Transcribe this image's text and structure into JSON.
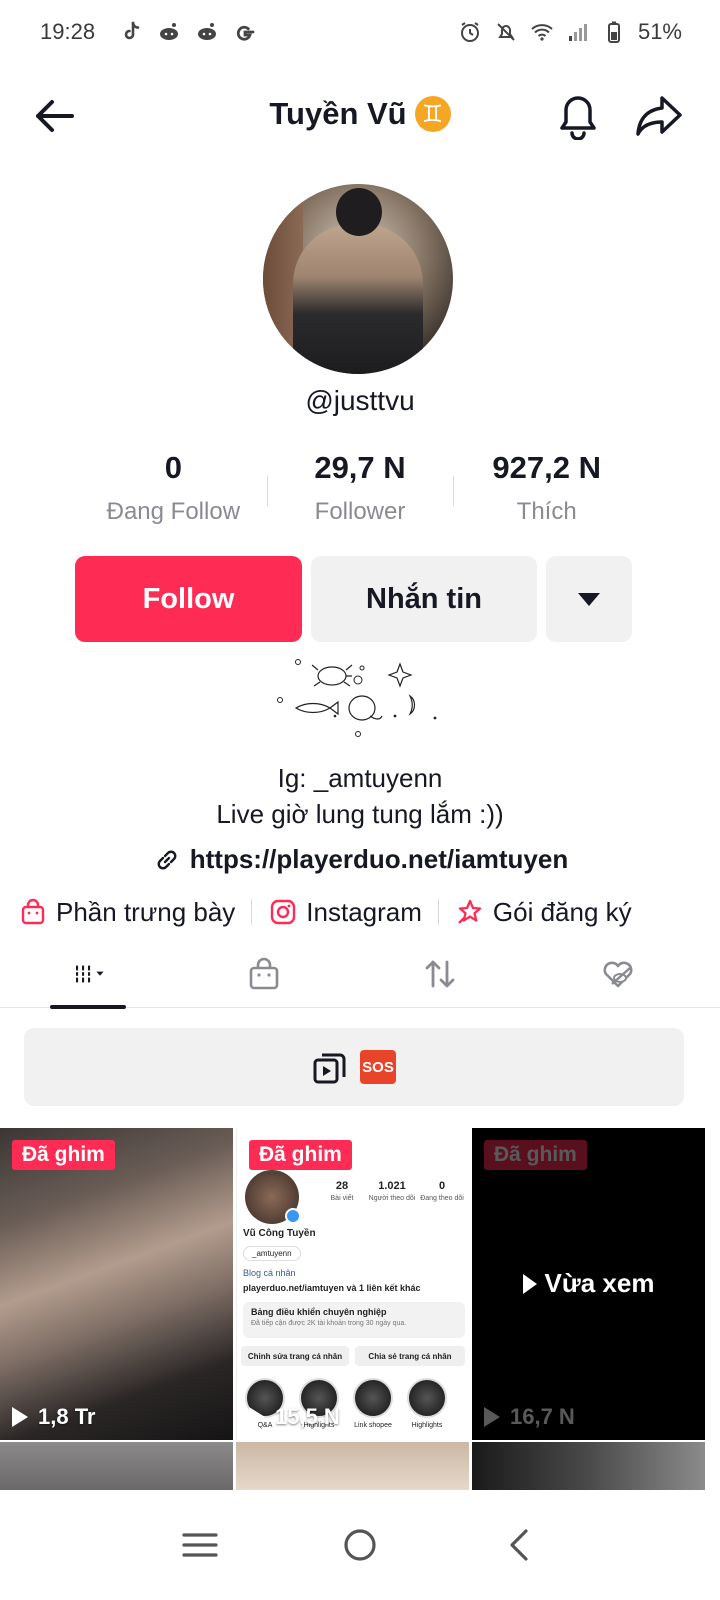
{
  "status_bar": {
    "time": "19:28",
    "battery": "51%"
  },
  "header": {
    "title": "Tuyền Vũ",
    "zodiac_symbol": "♊",
    "back_icon": "arrow-left-icon",
    "bell_icon": "bell-icon",
    "share_icon": "share-arrow-icon"
  },
  "profile": {
    "handle": "@justtvu",
    "stats": [
      {
        "value": "0",
        "label": "Đang Follow"
      },
      {
        "value": "29,7 N",
        "label": "Follower"
      },
      {
        "value": "927,2 N",
        "label": "Thích"
      }
    ]
  },
  "actions": {
    "follow_label": "Follow",
    "message_label": "Nhắn tin"
  },
  "bio": {
    "line1": "Ig: _amtuyenn",
    "line2": "Live giờ lung tung lắm :))",
    "link": "https://playerduo.net/iamtuyen"
  },
  "quick_links": [
    {
      "label": "Phần trưng bày",
      "icon": "shopping-bag-icon"
    },
    {
      "label": "Instagram",
      "icon": "instagram-icon"
    },
    {
      "label": "Gói đăng ký",
      "icon": "star-subscription-icon"
    }
  ],
  "tabs": [
    {
      "name": "videos",
      "icon": "grid-icon",
      "active": true
    },
    {
      "name": "shop",
      "icon": "shopping-bag-icon",
      "active": false
    },
    {
      "name": "reposts",
      "icon": "repost-icon",
      "active": false
    },
    {
      "name": "liked",
      "icon": "hidden-heart-icon",
      "active": false
    }
  ],
  "sos_bar": {
    "badge": "SOS"
  },
  "videos": [
    {
      "pinned_label": "Đã ghim",
      "views": "1,8 Tr"
    },
    {
      "pinned_label": "Đã ghim",
      "views": "15,5 N"
    },
    {
      "pinned_label": "Đã ghim",
      "views": "16,7 N",
      "overlay": "Vừa xem"
    }
  ],
  "ig_preview": {
    "posts_count": "28",
    "posts_label": "Bài viết",
    "followers_count": "1.021",
    "followers_label": "Người theo dõi",
    "following_count": "0",
    "following_label": "Đang theo dõi",
    "name": "Vũ Công Tuyền",
    "threads_handle": "_amtuyenn",
    "category": "Blog cá nhân",
    "link": "playerduo.net/iamtuyen và 1 liên kết khác",
    "dashboard_title": "Bảng điều khiển chuyên nghiệp",
    "dashboard_sub": "Đã tiếp cận được 2K tài khoản trong 30 ngày qua.",
    "edit_btn": "Chỉnh sửa trang cá nhân",
    "share_btn": "Chia sẻ trang cá nhân",
    "highlights": [
      "Q&A",
      "Highlights",
      "Link shopee",
      "Highlights"
    ]
  },
  "nav": {
    "recents_icon": "recents-icon",
    "home_icon": "home-circle-icon",
    "back_icon": "back-chevron-icon"
  },
  "colors": {
    "accent": "#fe2c55",
    "secondary_btn": "#f1f1f2",
    "muted_text": "#8a8b91"
  }
}
